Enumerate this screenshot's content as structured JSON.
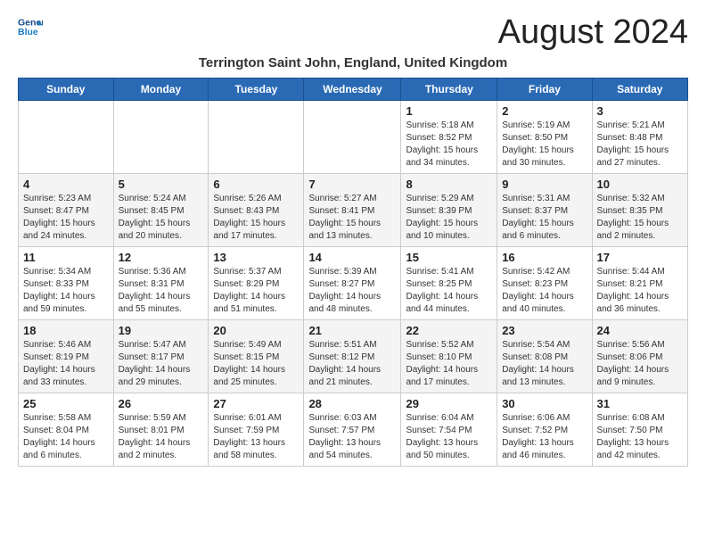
{
  "header": {
    "logo_line1": "General",
    "logo_line2": "Blue",
    "title": "August 2024",
    "subtitle": "Terrington Saint John, England, United Kingdom"
  },
  "weekdays": [
    "Sunday",
    "Monday",
    "Tuesday",
    "Wednesday",
    "Thursday",
    "Friday",
    "Saturday"
  ],
  "weeks": [
    [
      {
        "day": "",
        "sunrise": "",
        "sunset": "",
        "daylight": ""
      },
      {
        "day": "",
        "sunrise": "",
        "sunset": "",
        "daylight": ""
      },
      {
        "day": "",
        "sunrise": "",
        "sunset": "",
        "daylight": ""
      },
      {
        "day": "",
        "sunrise": "",
        "sunset": "",
        "daylight": ""
      },
      {
        "day": "1",
        "sunrise": "Sunrise: 5:18 AM",
        "sunset": "Sunset: 8:52 PM",
        "daylight": "Daylight: 15 hours and 34 minutes."
      },
      {
        "day": "2",
        "sunrise": "Sunrise: 5:19 AM",
        "sunset": "Sunset: 8:50 PM",
        "daylight": "Daylight: 15 hours and 30 minutes."
      },
      {
        "day": "3",
        "sunrise": "Sunrise: 5:21 AM",
        "sunset": "Sunset: 8:48 PM",
        "daylight": "Daylight: 15 hours and 27 minutes."
      }
    ],
    [
      {
        "day": "4",
        "sunrise": "Sunrise: 5:23 AM",
        "sunset": "Sunset: 8:47 PM",
        "daylight": "Daylight: 15 hours and 24 minutes."
      },
      {
        "day": "5",
        "sunrise": "Sunrise: 5:24 AM",
        "sunset": "Sunset: 8:45 PM",
        "daylight": "Daylight: 15 hours and 20 minutes."
      },
      {
        "day": "6",
        "sunrise": "Sunrise: 5:26 AM",
        "sunset": "Sunset: 8:43 PM",
        "daylight": "Daylight: 15 hours and 17 minutes."
      },
      {
        "day": "7",
        "sunrise": "Sunrise: 5:27 AM",
        "sunset": "Sunset: 8:41 PM",
        "daylight": "Daylight: 15 hours and 13 minutes."
      },
      {
        "day": "8",
        "sunrise": "Sunrise: 5:29 AM",
        "sunset": "Sunset: 8:39 PM",
        "daylight": "Daylight: 15 hours and 10 minutes."
      },
      {
        "day": "9",
        "sunrise": "Sunrise: 5:31 AM",
        "sunset": "Sunset: 8:37 PM",
        "daylight": "Daylight: 15 hours and 6 minutes."
      },
      {
        "day": "10",
        "sunrise": "Sunrise: 5:32 AM",
        "sunset": "Sunset: 8:35 PM",
        "daylight": "Daylight: 15 hours and 2 minutes."
      }
    ],
    [
      {
        "day": "11",
        "sunrise": "Sunrise: 5:34 AM",
        "sunset": "Sunset: 8:33 PM",
        "daylight": "Daylight: 14 hours and 59 minutes."
      },
      {
        "day": "12",
        "sunrise": "Sunrise: 5:36 AM",
        "sunset": "Sunset: 8:31 PM",
        "daylight": "Daylight: 14 hours and 55 minutes."
      },
      {
        "day": "13",
        "sunrise": "Sunrise: 5:37 AM",
        "sunset": "Sunset: 8:29 PM",
        "daylight": "Daylight: 14 hours and 51 minutes."
      },
      {
        "day": "14",
        "sunrise": "Sunrise: 5:39 AM",
        "sunset": "Sunset: 8:27 PM",
        "daylight": "Daylight: 14 hours and 48 minutes."
      },
      {
        "day": "15",
        "sunrise": "Sunrise: 5:41 AM",
        "sunset": "Sunset: 8:25 PM",
        "daylight": "Daylight: 14 hours and 44 minutes."
      },
      {
        "day": "16",
        "sunrise": "Sunrise: 5:42 AM",
        "sunset": "Sunset: 8:23 PM",
        "daylight": "Daylight: 14 hours and 40 minutes."
      },
      {
        "day": "17",
        "sunrise": "Sunrise: 5:44 AM",
        "sunset": "Sunset: 8:21 PM",
        "daylight": "Daylight: 14 hours and 36 minutes."
      }
    ],
    [
      {
        "day": "18",
        "sunrise": "Sunrise: 5:46 AM",
        "sunset": "Sunset: 8:19 PM",
        "daylight": "Daylight: 14 hours and 33 minutes."
      },
      {
        "day": "19",
        "sunrise": "Sunrise: 5:47 AM",
        "sunset": "Sunset: 8:17 PM",
        "daylight": "Daylight: 14 hours and 29 minutes."
      },
      {
        "day": "20",
        "sunrise": "Sunrise: 5:49 AM",
        "sunset": "Sunset: 8:15 PM",
        "daylight": "Daylight: 14 hours and 25 minutes."
      },
      {
        "day": "21",
        "sunrise": "Sunrise: 5:51 AM",
        "sunset": "Sunset: 8:12 PM",
        "daylight": "Daylight: 14 hours and 21 minutes."
      },
      {
        "day": "22",
        "sunrise": "Sunrise: 5:52 AM",
        "sunset": "Sunset: 8:10 PM",
        "daylight": "Daylight: 14 hours and 17 minutes."
      },
      {
        "day": "23",
        "sunrise": "Sunrise: 5:54 AM",
        "sunset": "Sunset: 8:08 PM",
        "daylight": "Daylight: 14 hours and 13 minutes."
      },
      {
        "day": "24",
        "sunrise": "Sunrise: 5:56 AM",
        "sunset": "Sunset: 8:06 PM",
        "daylight": "Daylight: 14 hours and 9 minutes."
      }
    ],
    [
      {
        "day": "25",
        "sunrise": "Sunrise: 5:58 AM",
        "sunset": "Sunset: 8:04 PM",
        "daylight": "Daylight: 14 hours and 6 minutes."
      },
      {
        "day": "26",
        "sunrise": "Sunrise: 5:59 AM",
        "sunset": "Sunset: 8:01 PM",
        "daylight": "Daylight: 14 hours and 2 minutes."
      },
      {
        "day": "27",
        "sunrise": "Sunrise: 6:01 AM",
        "sunset": "Sunset: 7:59 PM",
        "daylight": "Daylight: 13 hours and 58 minutes."
      },
      {
        "day": "28",
        "sunrise": "Sunrise: 6:03 AM",
        "sunset": "Sunset: 7:57 PM",
        "daylight": "Daylight: 13 hours and 54 minutes."
      },
      {
        "day": "29",
        "sunrise": "Sunrise: 6:04 AM",
        "sunset": "Sunset: 7:54 PM",
        "daylight": "Daylight: 13 hours and 50 minutes."
      },
      {
        "day": "30",
        "sunrise": "Sunrise: 6:06 AM",
        "sunset": "Sunset: 7:52 PM",
        "daylight": "Daylight: 13 hours and 46 minutes."
      },
      {
        "day": "31",
        "sunrise": "Sunrise: 6:08 AM",
        "sunset": "Sunset: 7:50 PM",
        "daylight": "Daylight: 13 hours and 42 minutes."
      }
    ]
  ]
}
